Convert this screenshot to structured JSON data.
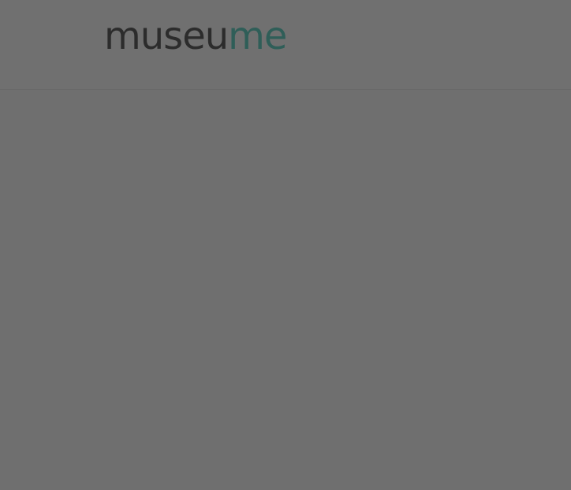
{
  "header": {
    "logo": {
      "text": "museume",
      "part_dark": "museu",
      "part_accent": "me"
    }
  },
  "colors": {
    "logo_dark": "#2c2c2c",
    "logo_accent": "#2f5e58",
    "overlay": "#6f6f6f"
  }
}
